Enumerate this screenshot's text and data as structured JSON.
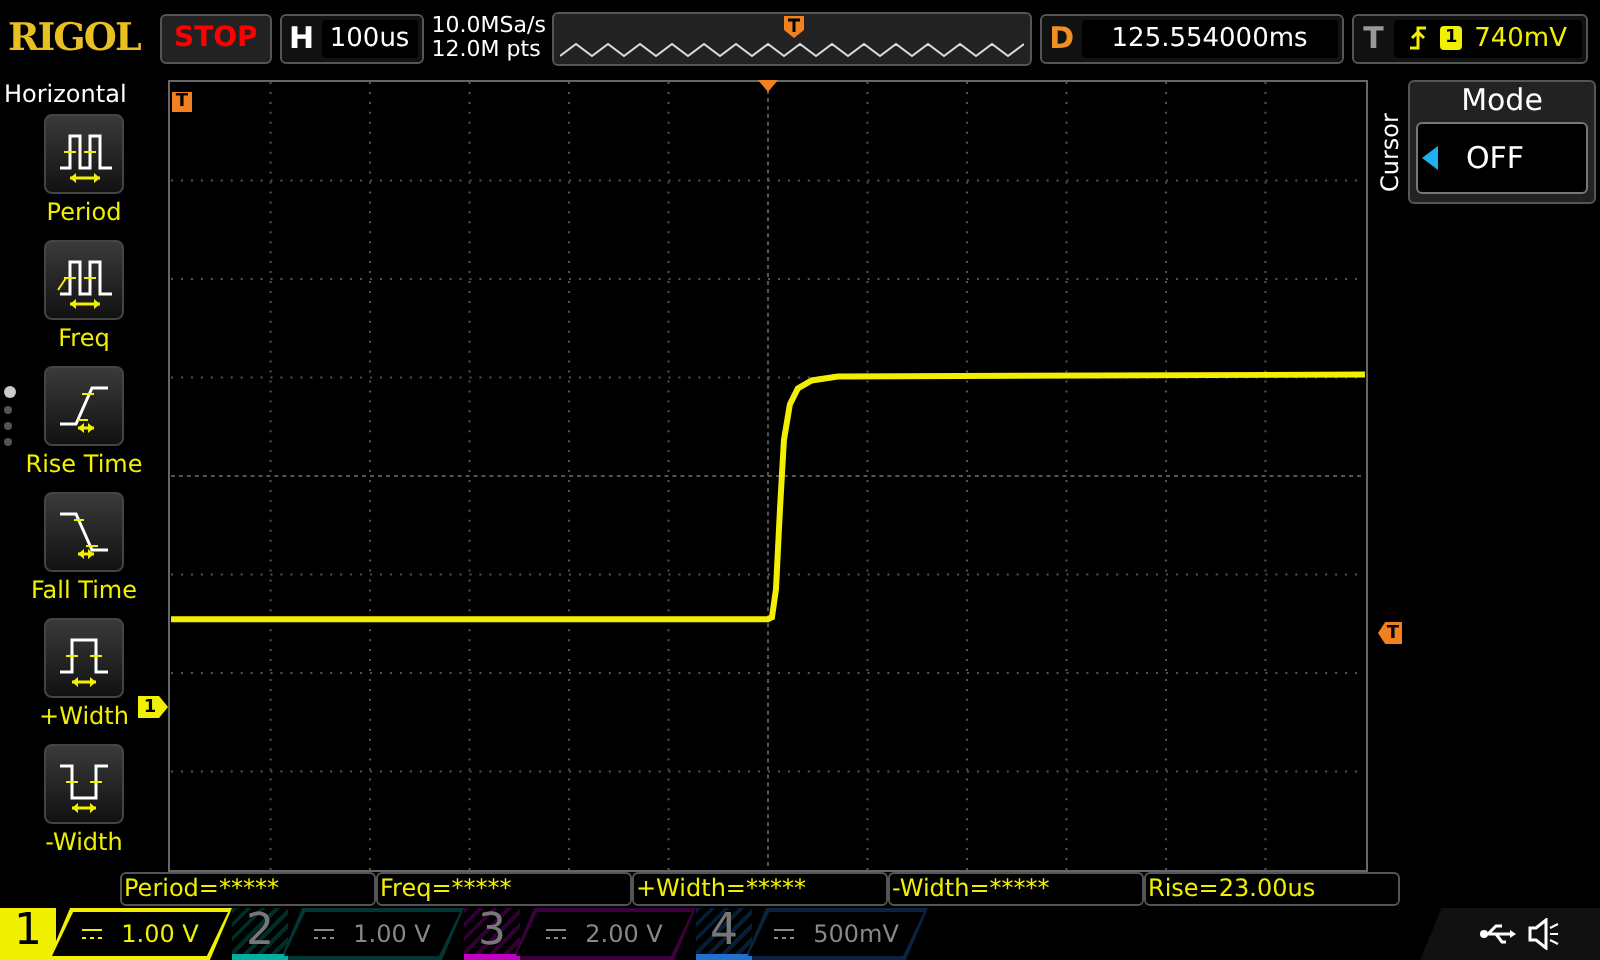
{
  "brand": "RIGOL",
  "run_state": "STOP",
  "timebase": {
    "label": "H",
    "value": "100us"
  },
  "sample_rate": "10.0MSa/s",
  "memory_depth": "12.0M pts",
  "delay": {
    "label": "D",
    "value": "125.554000ms"
  },
  "trigger": {
    "label": "T",
    "source": "1",
    "level": "740mV"
  },
  "menu": {
    "title": "Horizontal",
    "items": [
      {
        "label": "Period",
        "kind": "period"
      },
      {
        "label": "Freq",
        "kind": "freq"
      },
      {
        "label": "Rise Time",
        "kind": "rise"
      },
      {
        "label": "Fall Time",
        "kind": "fall"
      },
      {
        "label": "+Width",
        "kind": "pwidth"
      },
      {
        "label": "-Width",
        "kind": "nwidth"
      }
    ],
    "pages": [
      {
        "selected": true
      },
      {
        "selected": false
      },
      {
        "selected": false
      },
      {
        "selected": false
      }
    ]
  },
  "markers": {
    "trigger_position": "T",
    "trigger_level": "T",
    "channel": "1"
  },
  "cursor": {
    "side_label": "Cursor",
    "title": "Mode",
    "value": "OFF"
  },
  "measurements": [
    "Period=*****",
    "Freq=*****",
    "+Width=*****",
    "-Width=*****",
    "Rise=23.00us"
  ],
  "channels": [
    {
      "number": "1",
      "scale": "1.00 V",
      "selected": true,
      "color": "#f0f000"
    },
    {
      "number": "2",
      "scale": "1.00 V",
      "selected": false,
      "color": "#00b0a0"
    },
    {
      "number": "3",
      "scale": "2.00 V",
      "selected": false,
      "color": "#c000c0"
    },
    {
      "number": "4",
      "scale": "500mV",
      "selected": false,
      "color": "#2070d0"
    }
  ]
}
